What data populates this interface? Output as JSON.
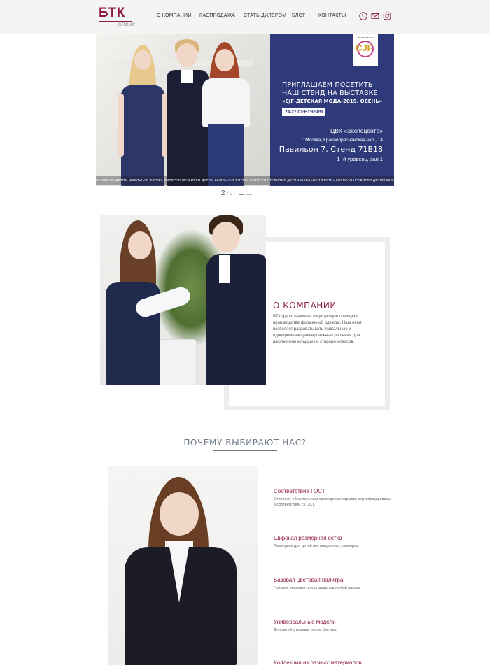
{
  "header": {
    "logo_main": "БТК",
    "logo_sub": "GROUP",
    "nav": [
      "О КОМПАНИИ",
      "РАСПРОДАЖА",
      "СТАТЬ ДИЛЕРОМ",
      "БЛОГ",
      "КОНТАКТЫ"
    ],
    "icons": [
      "phone-icon",
      "mail-icon",
      "instagram-icon"
    ]
  },
  "slider": {
    "badge_top": "ЯРМАРКА/EXPO",
    "badge_text": "CJF",
    "title_line1": "ПРИГЛАШАЕМ ПОСЕТИТЬ",
    "title_line2": "НАШ СТЕНД НА ВЫСТАВКЕ",
    "subtitle": "«CJF-ДЕТСКАЯ МОДА-2019. ОСЕНЬ»",
    "dates": "24-27 СЕНТЯБРЯ",
    "venue": "ЦВК «Экспоцентр»",
    "address": "г. Москва, Краснопресненская наб., 14",
    "pavilion": "Павильон 7, Стенд 71В18",
    "level": "1 -й уровень, зал 1",
    "ticker": "НРАВИТСЯ ДЕТЯМ ШКОЛЬНАЯ ФОРМА, КОТОРАЯ НРАВИТСЯ ДЕТЯМ ШКОЛЬНАЯ ФОРМА, КОТОРАЯ НРАВИТСЯ ДЕТЯМ ШКОЛЬНАЯ ФОРМА, КОТОРАЯ НРАВИТСЯ ДЕТЯМ ШКОЛЬНАЯ ФОРМА, КОТОРАЯ НРАВИТСЯ ДЕТЯМ ШКОЛЬНАЯ ФОРМА",
    "page_current": "2",
    "page_total": "/ 2"
  },
  "about": {
    "title": "О КОМПАНИИ",
    "text": "БТК групп занимает лидирующие позиции в производстве форменной одежды. Наш опыт позволяет разрабатывать уникальные и одновременно универсальные решения для школьников младших и старших классов."
  },
  "why": {
    "title": "ПОЧЕМУ ВЫБИРАЮТ НАС?",
    "features": [
      {
        "title": "Соответствие ГОСТ",
        "text": "Отвечают обязательным санитарным нормам, сертифицированы в соответствии с ГОСТ."
      },
      {
        "title": "Широкая размерная сетка",
        "text": "Размеры и для детей нестандартных размеров."
      },
      {
        "title": "Базовая цветовая палитра",
        "text": "Готовые решения для стандартов любой школы."
      },
      {
        "title": "Универсальные модели",
        "text": "Для детей с разным типом фигуры."
      },
      {
        "title": "Коллекции из разных материалов",
        "text": ""
      }
    ]
  },
  "colors": {
    "brand": "#8b1c3f",
    "panel": "#2e3a7a",
    "header_bg": "#f4f4f4"
  }
}
